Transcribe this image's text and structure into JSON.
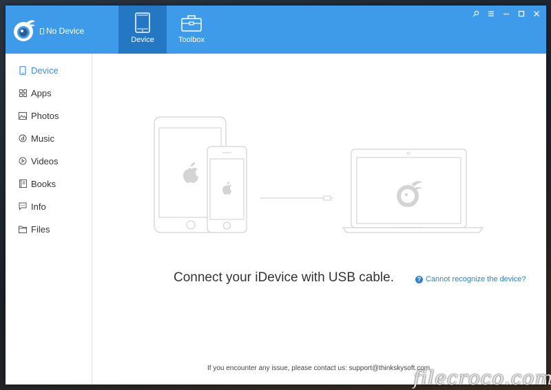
{
  "header": {
    "device_status": "No Device",
    "tabs": [
      {
        "label": "Device",
        "active": true,
        "icon": "tablet-icon"
      },
      {
        "label": "Toolbox",
        "active": false,
        "icon": "toolbox-icon"
      }
    ],
    "window_controls": [
      "pin-icon",
      "menu-icon",
      "minimize-icon",
      "maximize-icon",
      "close-icon"
    ]
  },
  "sidebar": {
    "items": [
      {
        "label": "Device",
        "icon": "phone-icon",
        "active": true
      },
      {
        "label": "Apps",
        "icon": "apps-grid-icon",
        "active": false
      },
      {
        "label": "Photos",
        "icon": "photo-icon",
        "active": false
      },
      {
        "label": "Music",
        "icon": "music-icon",
        "active": false
      },
      {
        "label": "Videos",
        "icon": "play-icon",
        "active": false
      },
      {
        "label": "Books",
        "icon": "book-icon",
        "active": false
      },
      {
        "label": "Info",
        "icon": "chat-icon",
        "active": false
      },
      {
        "label": "Files",
        "icon": "folder-icon",
        "active": false
      }
    ]
  },
  "main": {
    "connect_message": "Connect your iDevice with USB cable.",
    "help_link": "Cannot recognize the device?",
    "footer": "If you encounter any issue, please contact us: support@thinkskysoft.com"
  },
  "watermark": "filecroco.com",
  "colors": {
    "header_bg": "#3d9be9",
    "active_tab": "#2478c3",
    "accent": "#3d8fe0",
    "link": "#2a82d4"
  }
}
